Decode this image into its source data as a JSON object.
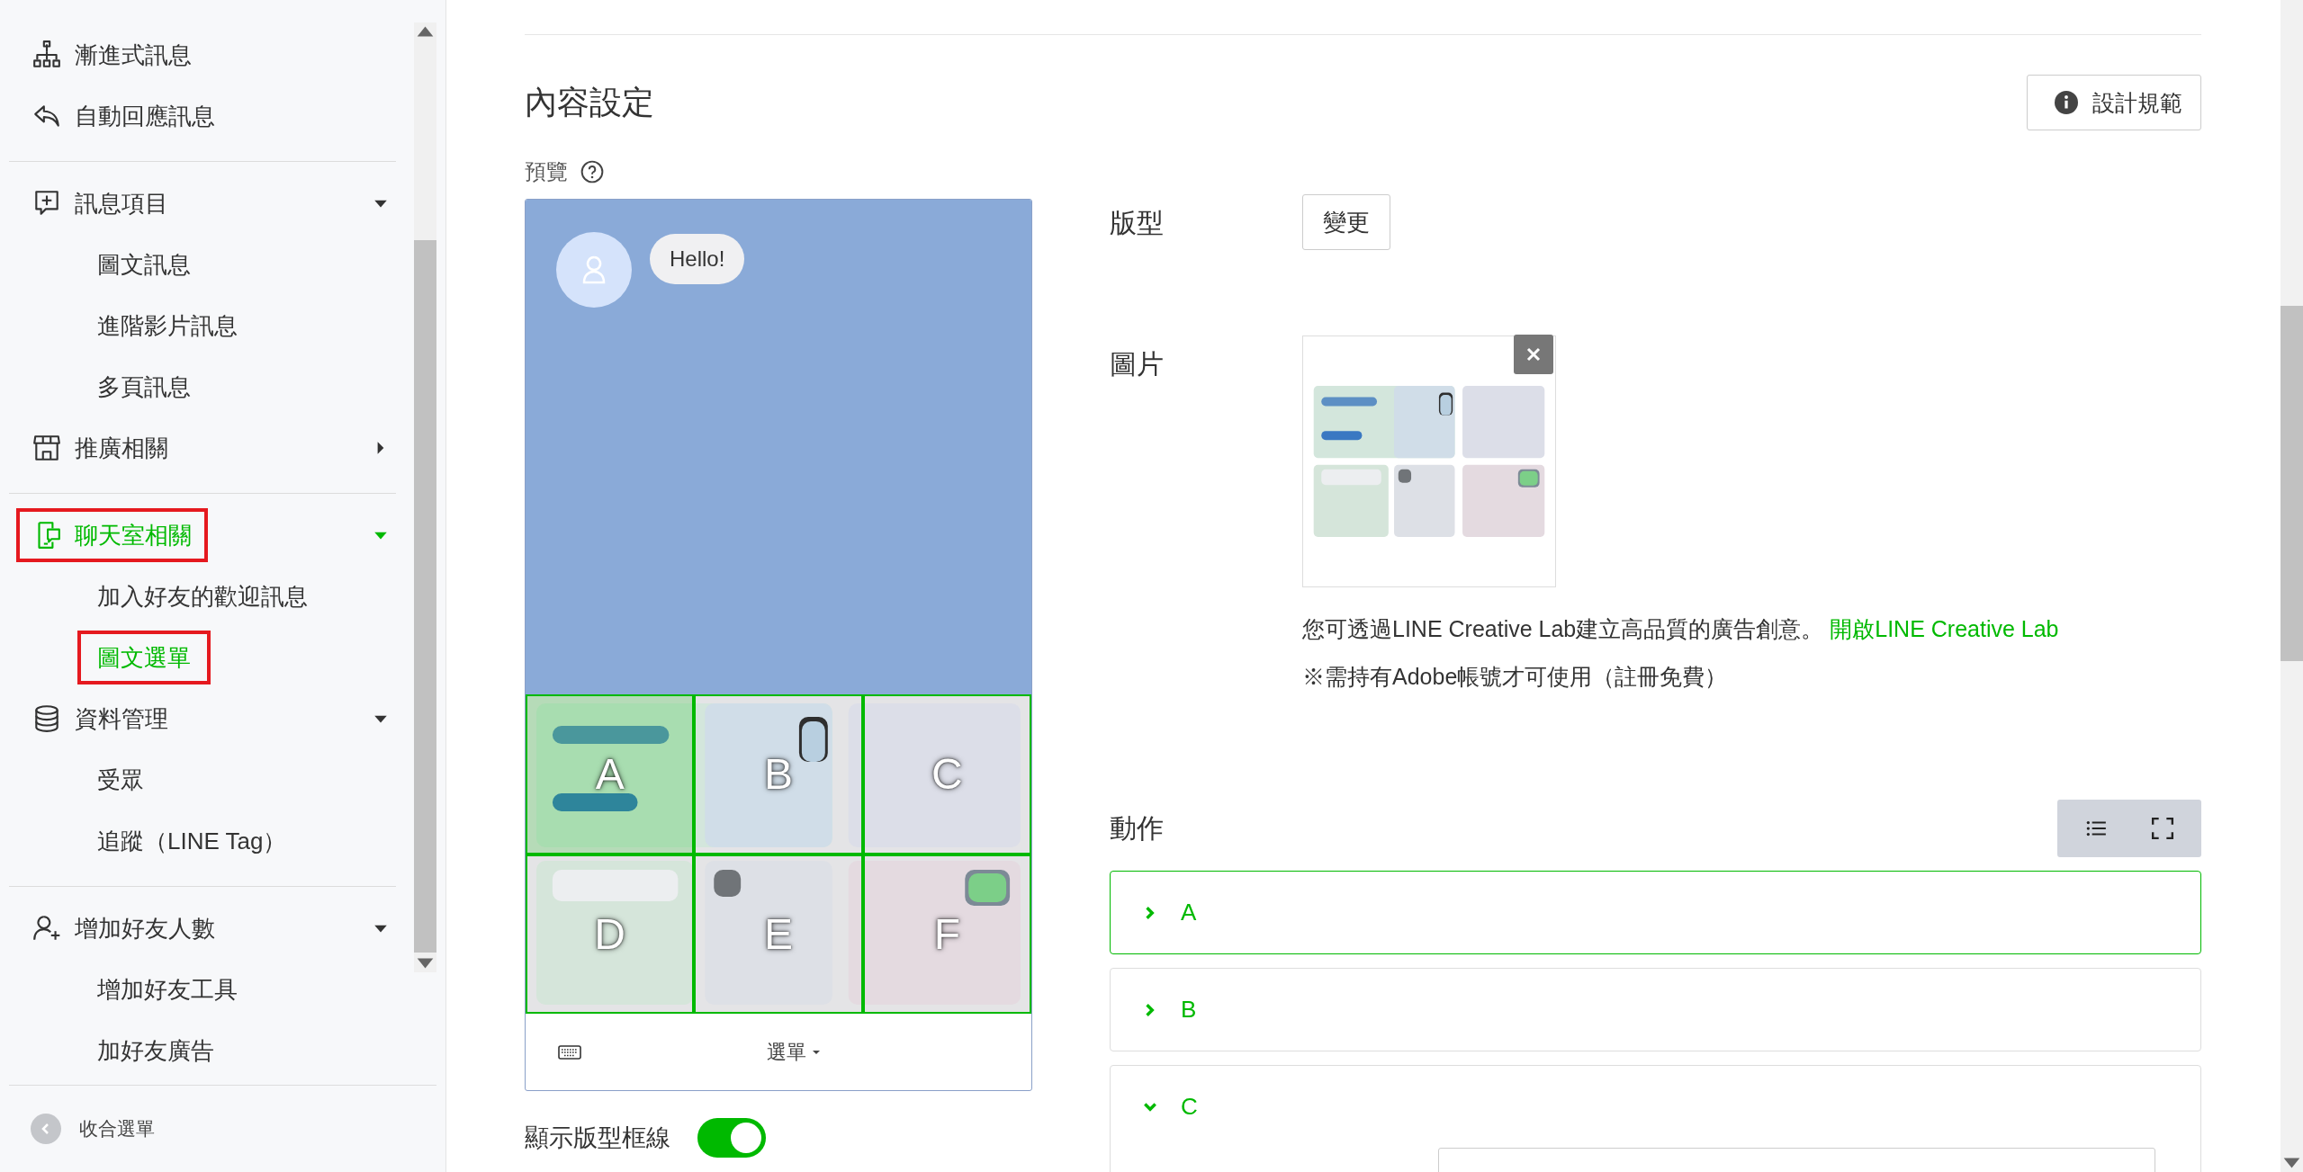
{
  "sidebar": {
    "sections": [
      {
        "items": [
          {
            "label": "漸進式訊息",
            "selected": false,
            "annotated": false
          },
          {
            "label": "自動回應訊息",
            "selected": false,
            "annotated": false
          }
        ]
      },
      {
        "items": [
          {
            "label": "訊息項目",
            "selected": false,
            "annotated": false,
            "expanded": true,
            "children": [
              {
                "label": "圖文訊息",
                "selected": false,
                "annotated": false
              },
              {
                "label": "進階影片訊息",
                "selected": false,
                "annotated": false
              },
              {
                "label": "多頁訊息",
                "selected": false,
                "annotated": false
              }
            ]
          },
          {
            "label": "推廣相關",
            "selected": false,
            "annotated": false,
            "expanded": false
          }
        ]
      },
      {
        "items": [
          {
            "label": "聊天室相關",
            "selected": true,
            "annotated": true,
            "expanded": true,
            "children": [
              {
                "label": "加入好友的歡迎訊息",
                "selected": false,
                "annotated": false
              },
              {
                "label": "圖文選單",
                "selected": true,
                "annotated": true
              }
            ]
          },
          {
            "label": "資料管理",
            "selected": false,
            "annotated": false,
            "expanded": true,
            "children": [
              {
                "label": "受眾",
                "selected": false,
                "annotated": false
              },
              {
                "label": "追蹤（LINE Tag）",
                "selected": false,
                "annotated": false
              }
            ]
          }
        ]
      },
      {
        "items": [
          {
            "label": "增加好友人數",
            "selected": false,
            "annotated": false,
            "expanded": true,
            "children": [
              {
                "label": "增加好友工具",
                "selected": false,
                "annotated": false
              },
              {
                "label": "加好友廣告",
                "selected": false,
                "annotated": false
              }
            ]
          }
        ]
      }
    ],
    "collapse_label": "收合選單"
  },
  "content": {
    "title": "內容設定",
    "guide_button": "設計規範",
    "preview_label": "預覽",
    "preview": {
      "message": "Hello!",
      "cells": [
        {
          "label": "A",
          "selected": true
        },
        {
          "label": "B",
          "selected": false
        },
        {
          "label": "C",
          "selected": false
        },
        {
          "label": "D",
          "selected": false
        },
        {
          "label": "E",
          "selected": false
        },
        {
          "label": "F",
          "selected": false
        }
      ],
      "menu_label": "選單",
      "grid_toggle": {
        "label": "顯示版型框線",
        "on": true
      }
    },
    "layout": {
      "label": "版型",
      "button": "變更"
    },
    "image": {
      "label": "圖片",
      "note": "您可透過LINE Creative Lab建立高品質的廣告創意。",
      "link": "開啟LINE Creative Lab",
      "note2": "※需持有Adobe帳號才可使用（註冊免費）"
    },
    "actions": {
      "title": "動作",
      "items": [
        {
          "label": "A",
          "selected": true,
          "expanded": false
        },
        {
          "label": "B",
          "selected": false,
          "expanded": false
        },
        {
          "label": "C",
          "selected": false,
          "expanded": true
        }
      ]
    }
  }
}
